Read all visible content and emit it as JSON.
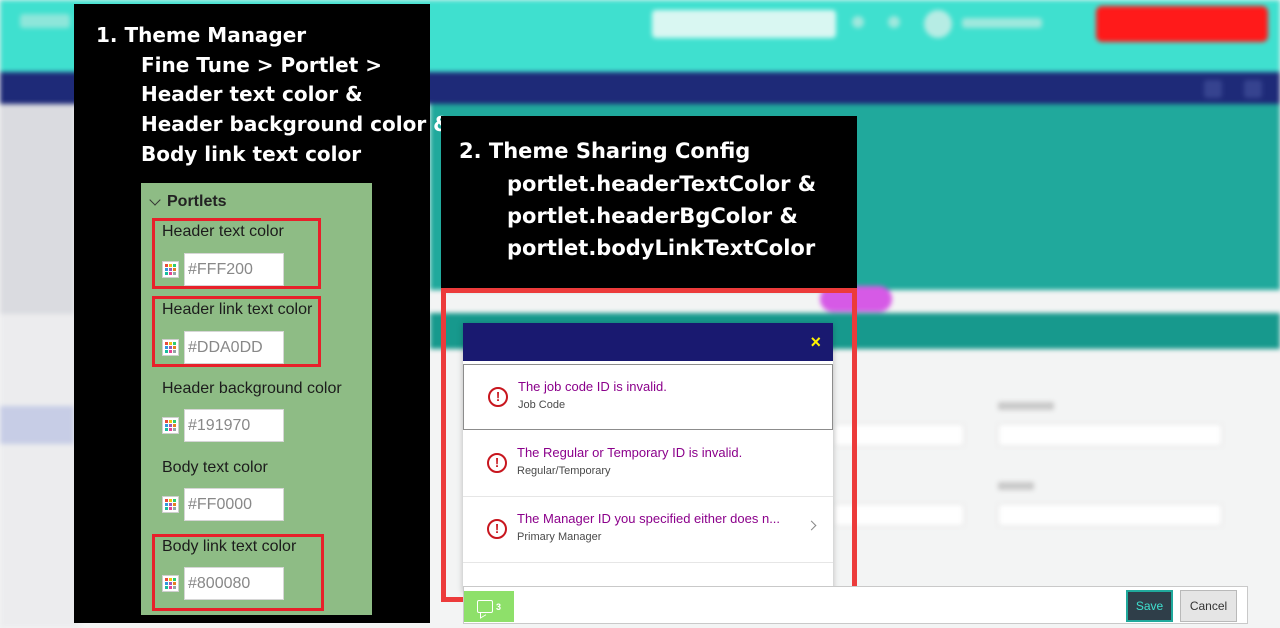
{
  "annotation1": {
    "lines": [
      "1.  Theme Manager",
      "Fine Tune > Portlet >",
      "Header text color &",
      "Header background color &",
      "Body link text color"
    ]
  },
  "portlets_panel": {
    "title": "Portlets",
    "fields": [
      {
        "label": "Header text color",
        "value": "#FFF200"
      },
      {
        "label": "Header link text color",
        "value": "#DDA0DD"
      },
      {
        "label": "Header background color",
        "value": "#191970"
      },
      {
        "label": "Body text color",
        "value": "#FF0000"
      },
      {
        "label": "Body link text color",
        "value": "#800080"
      }
    ]
  },
  "annotation2": {
    "lines": [
      "2. Theme Sharing Config",
      "portlet.headerTextColor &",
      "portlet.headerBgColor &",
      "portlet.bodyLinkTextColor"
    ]
  },
  "dialog": {
    "close_icon": "×",
    "messages": [
      {
        "title": "The job code ID is invalid.",
        "subtitle": "Job Code"
      },
      {
        "title": "The Regular or Temporary ID is invalid.",
        "subtitle": "Regular/Temporary"
      },
      {
        "title": "The Manager ID you specified either does n...",
        "subtitle": "Primary Manager"
      }
    ]
  },
  "footer": {
    "feedback_count": "3",
    "save_label": "Save",
    "cancel_label": "Cancel"
  },
  "colors": {
    "header_bg": "#191970",
    "header_text": "#FFF200",
    "body_link_text": "#800080",
    "app_top": "#3FE0CF",
    "error": "#C8161E"
  }
}
